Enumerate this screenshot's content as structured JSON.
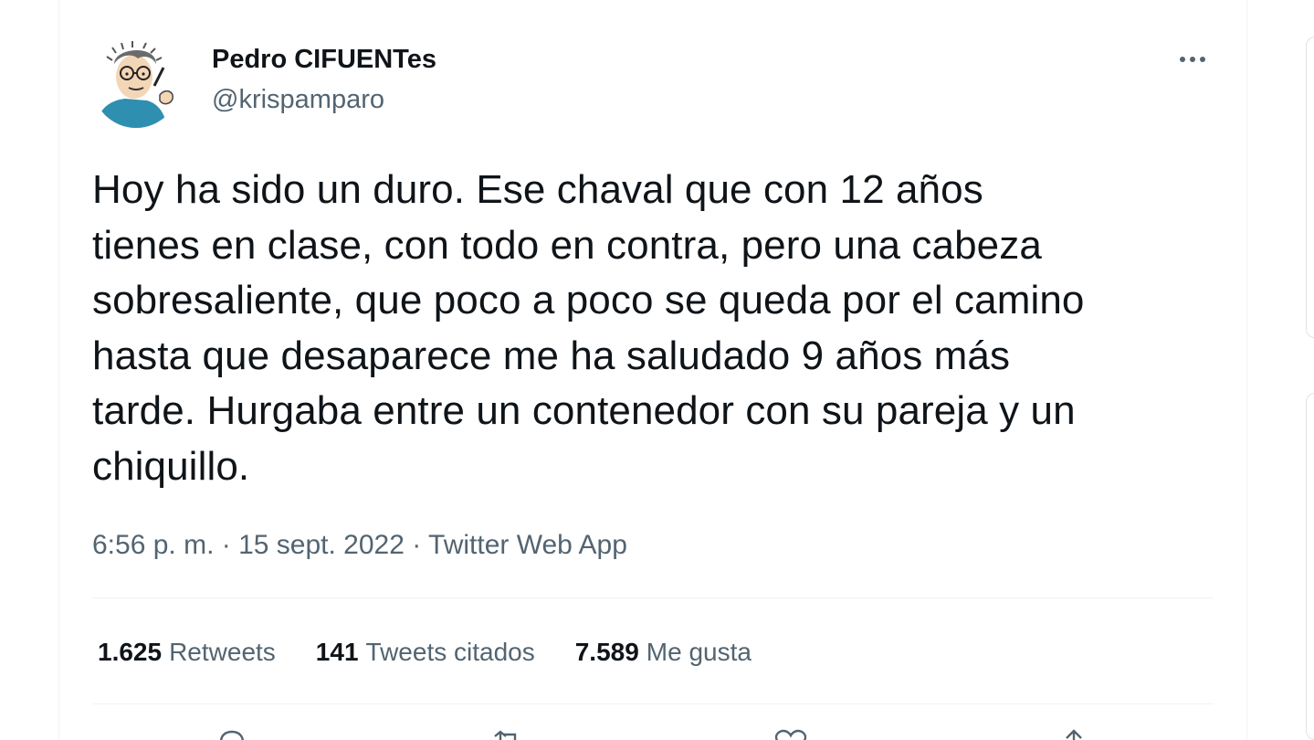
{
  "user": {
    "display_name": "Pedro CIFUENTes",
    "handle": "@krispamparo"
  },
  "tweet": {
    "text": "Hoy ha sido un duro. Ese chaval que con 12 años\ntienes en clase, con todo en contra, pero una cabeza\nsobresaliente, que poco a poco se queda por el camino\nhasta que desaparece me ha saludado 9 años más\ntarde. Hurgaba entre un contenedor con su pareja y un\nchiquillo.",
    "time": "6:56 p. m.",
    "date": "15 sept. 2022",
    "separator": " · ",
    "source": "Twitter Web App"
  },
  "stats": [
    {
      "count": "1.625",
      "label": "Retweets"
    },
    {
      "count": "141",
      "label": "Tweets citados"
    },
    {
      "count": "7.589",
      "label": "Me gusta"
    }
  ],
  "icons": {
    "more": "more-horizontal-icon",
    "reply": "reply-icon",
    "retweet": "retweet-icon",
    "like": "heart-icon",
    "share": "share-icon"
  },
  "colors": {
    "primary_text": "#0f1419",
    "secondary_text": "#536471",
    "divider": "#eff3f4"
  }
}
